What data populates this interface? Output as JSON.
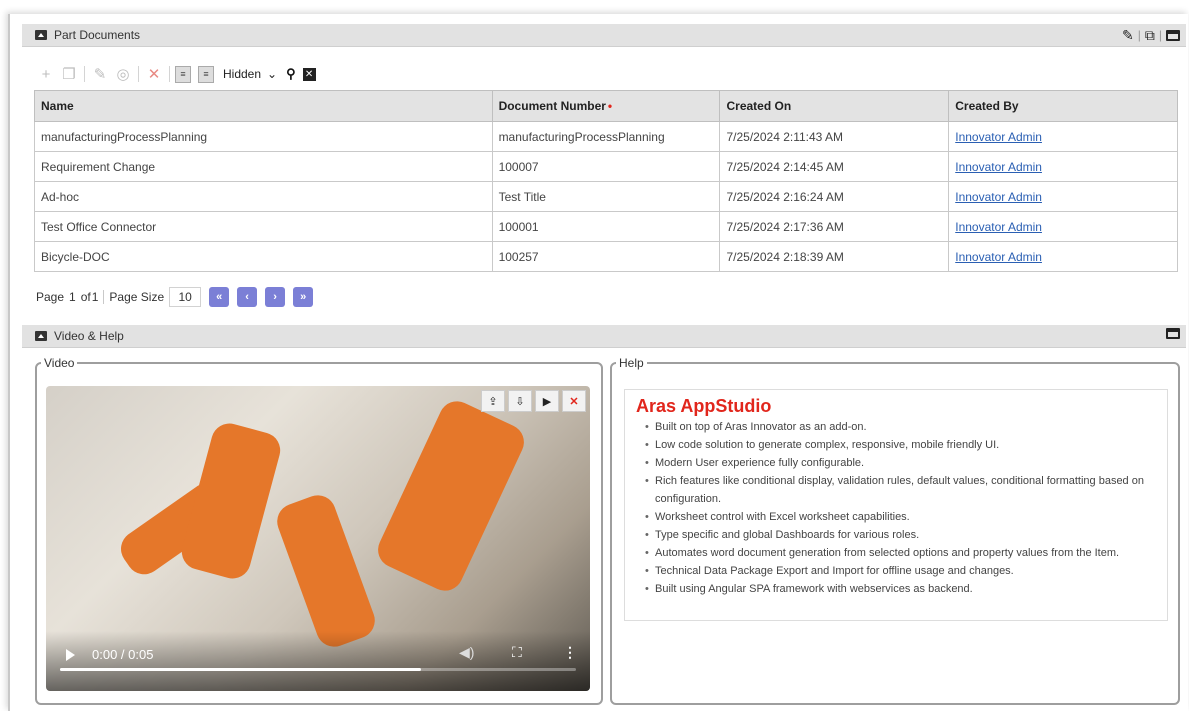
{
  "part_documents": {
    "title": "Part Documents",
    "actions": [
      "edit-icon",
      "open-external-icon",
      "maximize-icon"
    ],
    "toolbar": {
      "select_value": "Hidden",
      "icons": [
        "add-icon",
        "copy-icon",
        "edit-icon",
        "view-icon",
        "delete-icon",
        "doc-icon",
        "doc-icon",
        "search-icon",
        "clear-icon"
      ]
    },
    "columns": [
      "Name",
      "Document Number",
      "Created On",
      "Created By"
    ],
    "rows": [
      {
        "name": "manufacturingProcessPlanning",
        "number": "manufacturingProcessPlanning",
        "created_on": "7/25/2024 2:11:43 AM",
        "created_by": "Innovator Admin"
      },
      {
        "name": "Requirement Change",
        "number": "100007",
        "created_on": "7/25/2024 2:14:45 AM",
        "created_by": "Innovator Admin"
      },
      {
        "name": "Ad-hoc",
        "number": "Test Title",
        "created_on": "7/25/2024 2:16:24 AM",
        "created_by": "Innovator Admin"
      },
      {
        "name": "Test Office Connector",
        "number": "100001",
        "created_on": "7/25/2024 2:17:36 AM",
        "created_by": "Innovator Admin"
      },
      {
        "name": "Bicycle-DOC",
        "number": "100257",
        "created_on": "7/25/2024 2:18:39 AM",
        "created_by": "Innovator Admin"
      }
    ],
    "pager": {
      "page_label": "Page",
      "page": "1",
      "of_label": "of",
      "total": "1",
      "page_size_label": "Page Size",
      "page_size": "10"
    }
  },
  "video_help": {
    "title": "Video & Help",
    "video": {
      "legend": "Video",
      "time": "0:00 / 0:05",
      "progress": 0.7
    },
    "help": {
      "legend": "Help",
      "heading": "Aras AppStudio",
      "items": [
        "Built on top of Aras Innovator as an add-on.",
        "Low code solution to generate complex, responsive, mobile friendly UI.",
        "Modern User experience fully configurable.",
        "Rich features like conditional display, validation rules, default values, conditional formatting based on configuration.",
        "Worksheet control with Excel worksheet capabilities.",
        "Type specific and global Dashboards for various roles.",
        "Automates word document generation from selected options and property values from the Item.",
        "Technical Data Package Export and Import for offline usage and changes.",
        "Built using Angular SPA framework with webservices as backend."
      ]
    }
  },
  "colors": {
    "accent": "#7b7fd6",
    "link": "#2a5fb3",
    "help_title": "#e1261c",
    "header_bg": "#e2e2e2"
  }
}
